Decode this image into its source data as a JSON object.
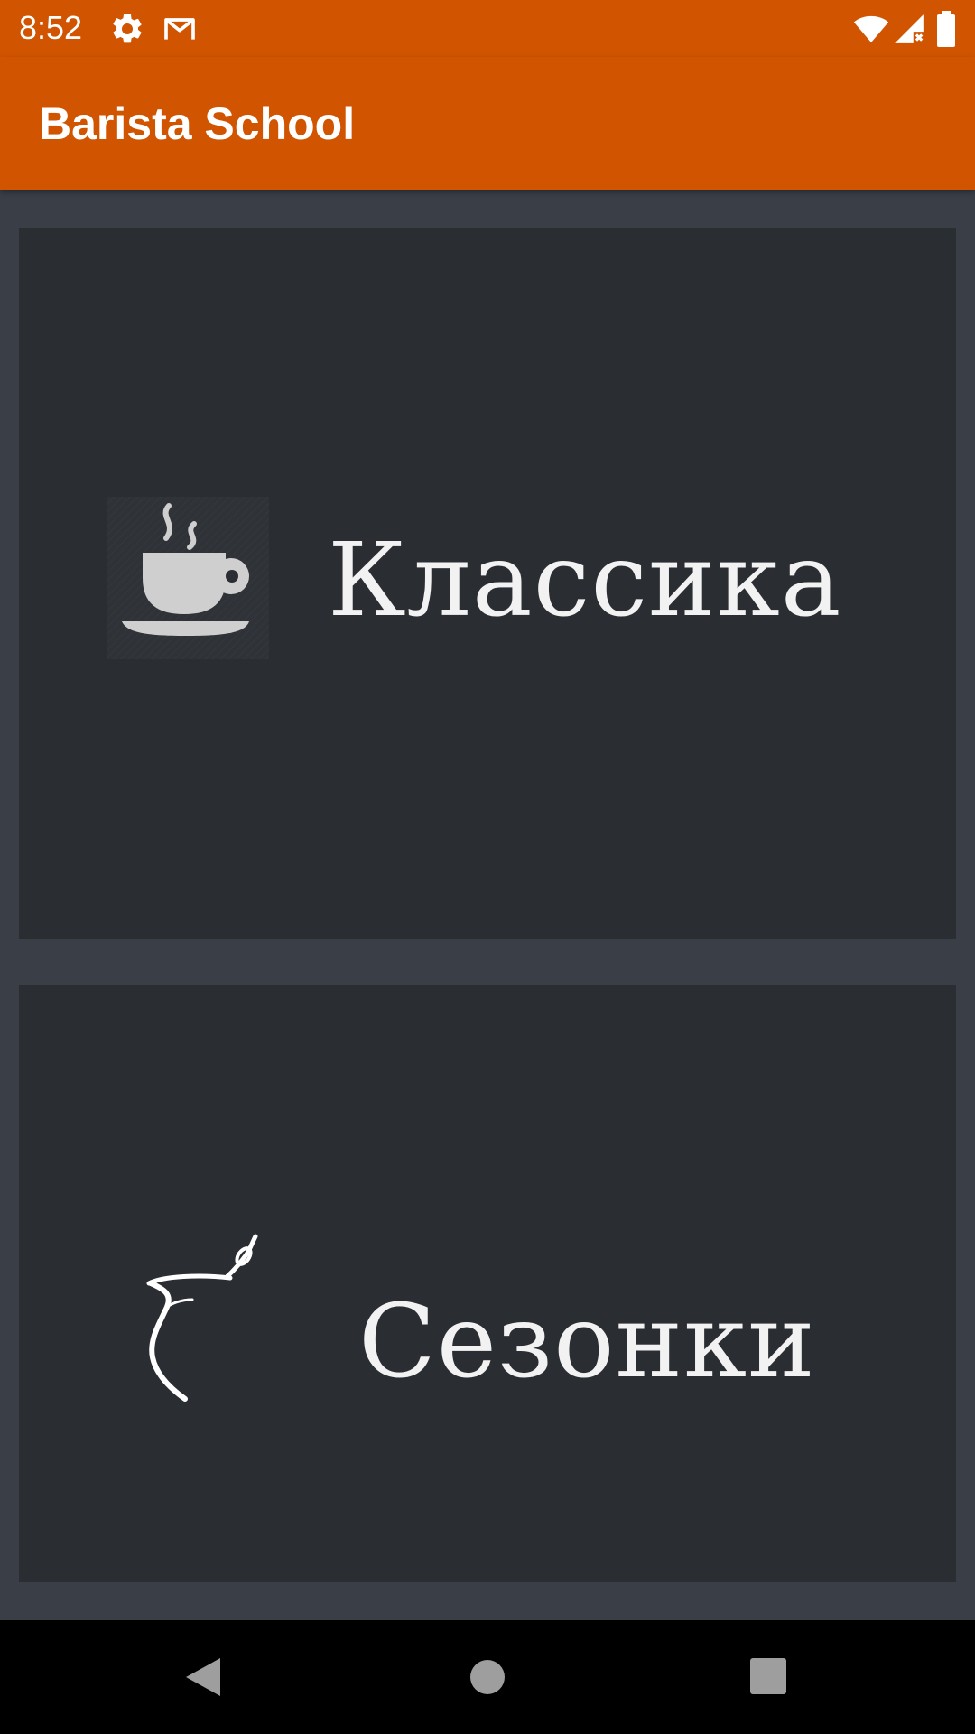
{
  "status_bar": {
    "time": "8:52",
    "icons": [
      "settings-icon",
      "gmail-icon",
      "wifi-icon",
      "signal-icon",
      "battery-icon"
    ]
  },
  "app_bar": {
    "title": "Barista School"
  },
  "categories": [
    {
      "label": "Классика",
      "icon": "coffee-cup-icon"
    },
    {
      "label": "Сезонки",
      "icon": "cezve-icon"
    }
  ],
  "nav_bar": {
    "icons": [
      "back-icon",
      "home-icon",
      "recents-icon"
    ]
  },
  "colors": {
    "accent": "#d15400",
    "background": "#3a3f47",
    "card": "#2a2d32",
    "text": "#f2f2f2"
  }
}
